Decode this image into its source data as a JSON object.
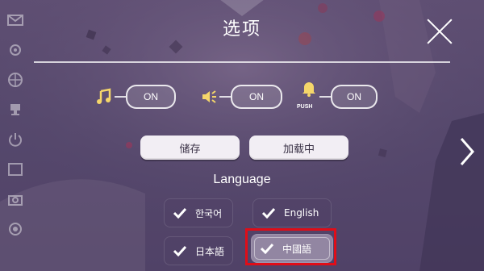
{
  "header": {
    "title": "选项"
  },
  "toggles": [
    {
      "icon": "music-note-icon",
      "state": "ON"
    },
    {
      "icon": "speaker-icon",
      "state": "ON"
    },
    {
      "icon": "bell-icon",
      "badge": "PUSH",
      "state": "ON"
    }
  ],
  "actions": {
    "save_label": "储存",
    "load_label": "加载中"
  },
  "language": {
    "title": "Language",
    "options": [
      "한국어",
      "English",
      "日本語",
      "中國語"
    ],
    "selected": "中國語"
  },
  "colors": {
    "highlight": "#e00d18",
    "accent_gold": "#f5d66a"
  }
}
